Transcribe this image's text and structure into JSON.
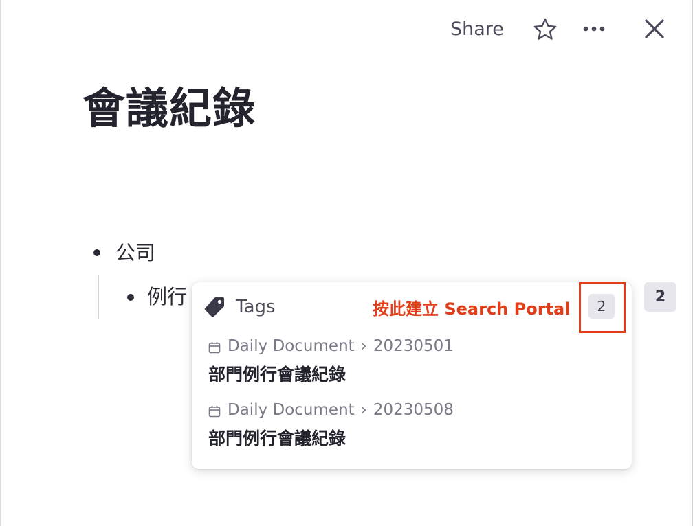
{
  "topbar": {
    "share_label": "Share",
    "star_icon": "star-icon",
    "more_icon": "more-horizontal-icon",
    "close_icon": "close-icon"
  },
  "page": {
    "title": "會議紀錄"
  },
  "outline": {
    "items": [
      {
        "text": "公司"
      },
      {
        "text": "例行"
      }
    ],
    "count_badge": "2"
  },
  "popover": {
    "icon": "tag-icon",
    "label": "Tags",
    "annotation": "按此建立 Search Portal",
    "count": "2",
    "results": [
      {
        "path": [
          "Daily Document",
          "20230501"
        ],
        "title": "部門例行會議紀錄"
      },
      {
        "path": [
          "Daily Document",
          "20230508"
        ],
        "title": "部門例行會議紀錄"
      }
    ]
  },
  "breadcrumb_separator": "›",
  "colors": {
    "annotation": "#e03e1a",
    "badge_bg": "#e6e6ec",
    "text": "#2b2b36"
  }
}
